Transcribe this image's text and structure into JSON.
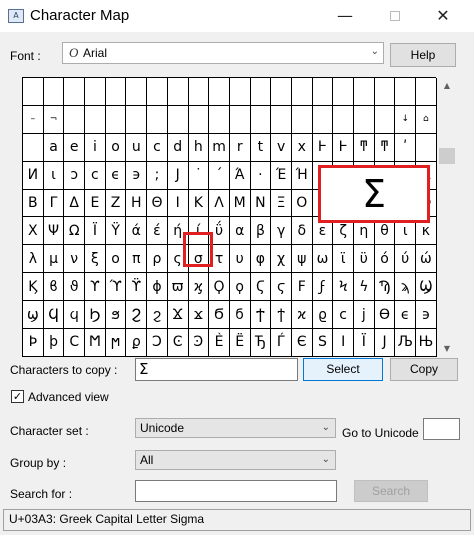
{
  "window": {
    "title": "Character Map",
    "icon": "charmap-app-icon",
    "icon_glyph": "A",
    "min_glyph": "—",
    "close_glyph": "✕"
  },
  "font_row": {
    "label": "Font :",
    "icon_glyph": "O",
    "value": "Arial",
    "arrow": "⌄",
    "help_label": "Help"
  },
  "grid": {
    "columns": 20,
    "rows": [
      [
        "",
        "",
        "",
        "",
        "",
        "",
        "",
        "",
        "",
        "",
        "",
        "",
        "",
        "",
        "",
        "",
        "",
        "",
        "",
        ""
      ],
      [
        "–",
        "¬",
        "",
        "",
        "",
        "",
        "",
        "",
        "",
        "",
        "",
        "",
        "",
        "",
        "",
        "",
        "",
        "",
        "↓",
        "⌂"
      ],
      [
        "",
        "a",
        "e",
        "i",
        "o",
        "u",
        "c",
        "d",
        "h",
        "m",
        "r",
        "t",
        "v",
        "x",
        "Ⱶ",
        "Ͱ",
        "ͳ",
        "ͳ",
        "ʹ",
        ""
      ],
      [
        "И",
        "ɩ",
        "ɔ",
        "ϲ",
        "ϵ",
        "϶",
        ";",
        "J",
        "˙",
        "´",
        "Ά",
        "·",
        "Έ",
        "Ή",
        "Ί",
        "Ό",
        "Ύ",
        "Ώ",
        "ΐ",
        "Α"
      ],
      [
        "Β",
        "Γ",
        "Δ",
        "Ε",
        "Ζ",
        "Η",
        "Θ",
        "Ι",
        "Κ",
        "Λ",
        "Μ",
        "Ν",
        "Ξ",
        "Ο",
        "Π",
        "Ρ",
        "Σ",
        "Τ",
        "Υ",
        "Φ"
      ],
      [
        "Χ",
        "Ψ",
        "Ω",
        "Ϊ",
        "Ϋ",
        "ά",
        "έ",
        "ή",
        "ί",
        "ΰ",
        "α",
        "β",
        "γ",
        "δ",
        "ε",
        "ζ",
        "η",
        "θ",
        "ι",
        "κ"
      ],
      [
        "λ",
        "μ",
        "ν",
        "ξ",
        "ο",
        "π",
        "ρ",
        "ς",
        "σ",
        "τ",
        "υ",
        "φ",
        "χ",
        "ψ",
        "ω",
        "ϊ",
        "ϋ",
        "ό",
        "ύ",
        "ώ"
      ],
      [
        "Ϗ",
        "ϐ",
        "ϑ",
        "ϒ",
        "ϓ",
        "ϔ",
        "ϕ",
        "ϖ",
        "ϗ",
        "Ϙ",
        "ϙ",
        "Ϛ",
        "ϛ",
        "Ϝ",
        "ϝ",
        "Ϟ",
        "ϟ",
        "Ϡ",
        "ϡ",
        "Ϣ"
      ],
      [
        "ϣ",
        "Ϥ",
        "ϥ",
        "Ϧ",
        "ϧ",
        "Ϩ",
        "ϩ",
        "Ϫ",
        "ϫ",
        "Ϭ",
        "ϭ",
        "Ϯ",
        "ϯ",
        "ϰ",
        "ϱ",
        "ϲ",
        "ϳ",
        "ϴ",
        "ϵ",
        "϶"
      ],
      [
        "Ϸ",
        "ϸ",
        "Ϲ",
        "Ϻ",
        "ϻ",
        "ϼ",
        "Ͻ",
        "Ͼ",
        "Ͽ",
        "Ѐ",
        "Ё",
        "Ђ",
        "Ѓ",
        "Є",
        "Ѕ",
        "І",
        "Ї",
        "Ј",
        "Љ",
        "Њ"
      ]
    ],
    "selected_char": "σ",
    "magnified_char": "Σ"
  },
  "scrollbar": {
    "up_glyph": "▲",
    "down_glyph": "▼"
  },
  "copy_row": {
    "label": "Characters to copy :",
    "value": "Σ",
    "select_label": "Select",
    "copy_label": "Copy"
  },
  "advanced": {
    "checked": true,
    "check_glyph": "✓",
    "label": "Advanced view"
  },
  "charset_row": {
    "label": "Character set :",
    "value": "Unicode",
    "goto_label": "Go to Unicode :",
    "goto_value": ""
  },
  "groupby_row": {
    "label": "Group by :",
    "value": "All"
  },
  "search_row": {
    "label": "Search for :",
    "value": "",
    "button_label": "Search"
  },
  "dropdown_arrow": "⌄",
  "status": {
    "text": "U+03A3: Greek Capital Letter Sigma"
  },
  "colors": {
    "highlight": "#e02020",
    "window_bg": "#f0f0f0"
  }
}
